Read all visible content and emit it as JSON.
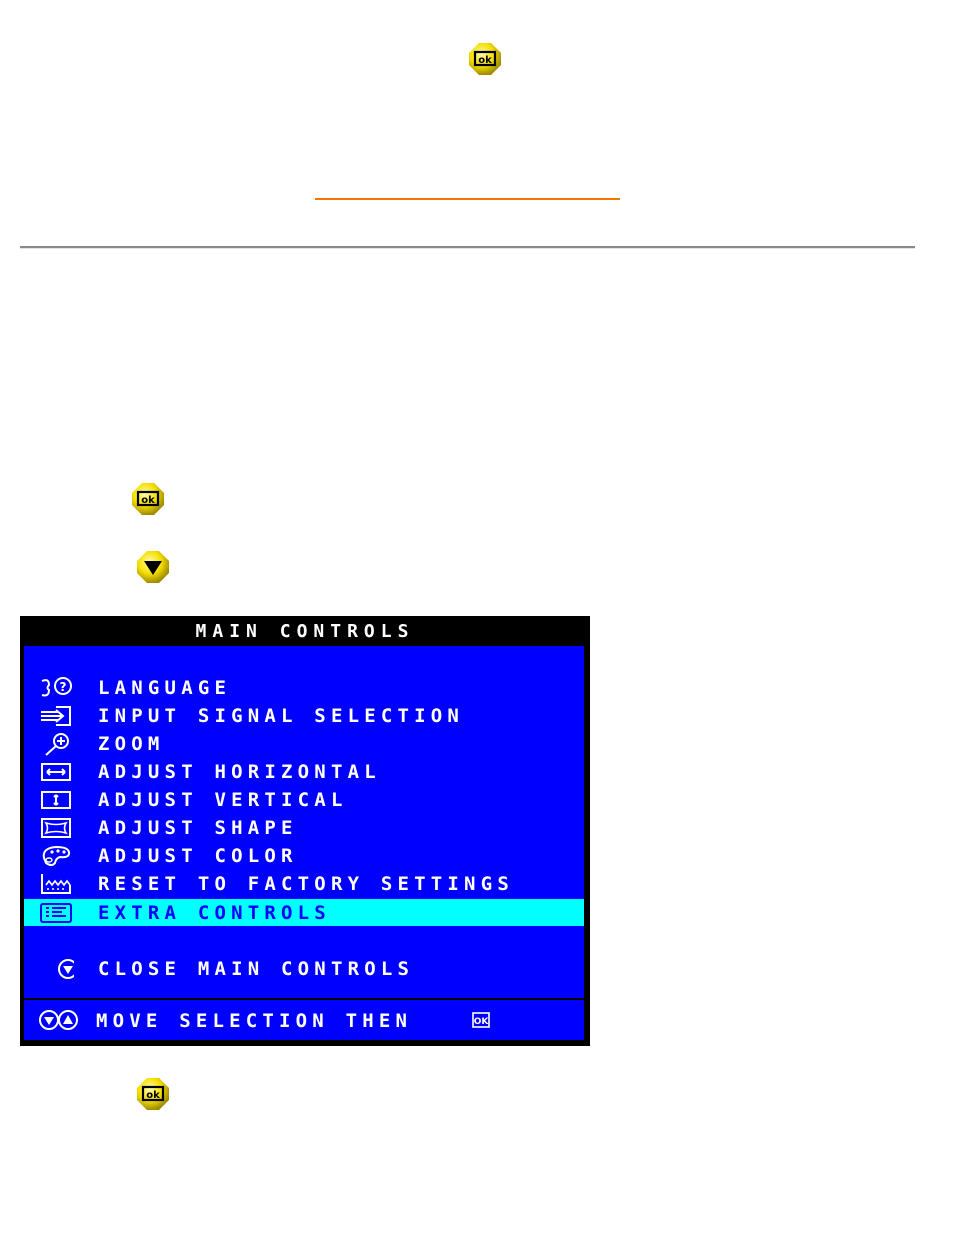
{
  "page": {
    "icons": [
      {
        "name": "ok-button-icon",
        "label": "OK"
      },
      {
        "name": "ok-button-icon",
        "label": "OK"
      },
      {
        "name": "down-button-icon",
        "label": "down"
      },
      {
        "name": "ok-button-icon",
        "label": "OK"
      }
    ],
    "colors": {
      "link_underline": "#f07800",
      "button_yellow": "#f5e000",
      "osd_blue": "#0000ff",
      "osd_highlight": "#00ffff",
      "osd_black": "#000000"
    }
  },
  "osd": {
    "title": "MAIN CONTROLS",
    "items": [
      {
        "label": "LANGUAGE",
        "icon": "language-icon",
        "selected": false
      },
      {
        "label": "INPUT SIGNAL SELECTION",
        "icon": "input-signal-icon",
        "selected": false
      },
      {
        "label": "ZOOM",
        "icon": "zoom-icon",
        "selected": false
      },
      {
        "label": "ADJUST HORIZONTAL",
        "icon": "horizontal-icon",
        "selected": false
      },
      {
        "label": "ADJUST VERTICAL",
        "icon": "vertical-icon",
        "selected": false
      },
      {
        "label": "ADJUST SHAPE",
        "icon": "shape-icon",
        "selected": false
      },
      {
        "label": "ADJUST COLOR",
        "icon": "color-palette-icon",
        "selected": false
      },
      {
        "label": "RESET TO FACTORY SETTINGS",
        "icon": "factory-reset-icon",
        "selected": false
      },
      {
        "label": "EXTRA CONTROLS",
        "icon": "extra-controls-icon",
        "selected": true
      }
    ],
    "close": {
      "label": "CLOSE MAIN CONTROLS",
      "icon": "down-circle-icon"
    },
    "footer": {
      "label": "MOVE SELECTION THEN",
      "icon": "up-down-icon",
      "ok_icon": "ok-icon"
    }
  }
}
